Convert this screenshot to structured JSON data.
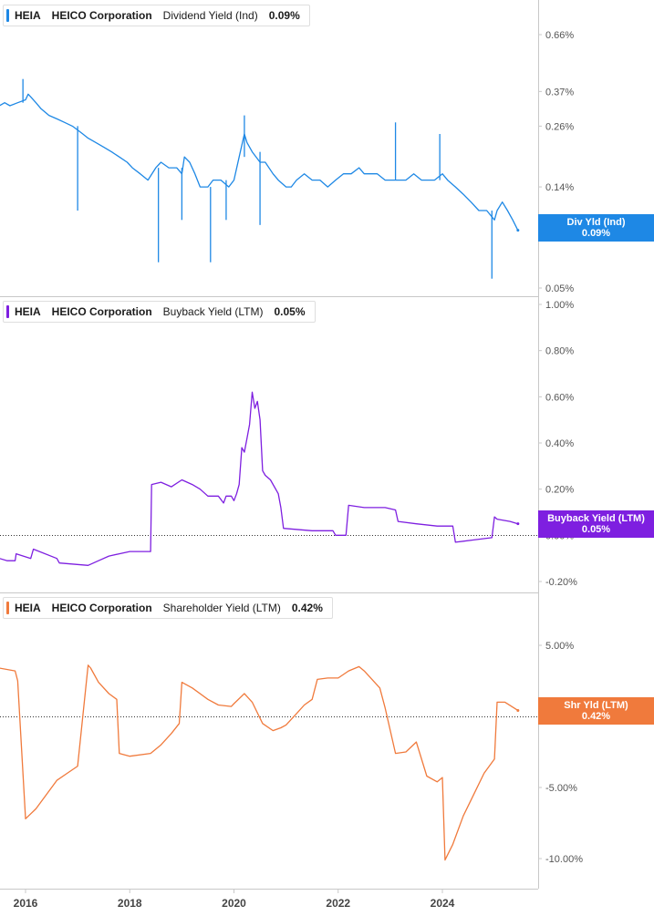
{
  "chart_data": [
    {
      "type": "line",
      "ticker": "HEIA",
      "company": "HEICO Corporation",
      "metric": "Dividend Yield (Ind)",
      "current": "0.09%",
      "tag_label": "Div Yld (Ind)",
      "tag_value": "0.09%",
      "color": "#1e88e5",
      "scale": "log",
      "y_ticks": [
        "0.66%",
        "0.37%",
        "0.26%",
        "0.14%",
        "0.05%"
      ],
      "y_tick_values": [
        0.66,
        0.37,
        0.26,
        0.14,
        0.05
      ],
      "x": [
        2015.5,
        2015.6,
        2015.7,
        2015.85,
        2016.0,
        2016.05,
        2016.1,
        2016.2,
        2016.3,
        2016.45,
        2016.6,
        2016.75,
        2016.9,
        2017.0,
        2017.1,
        2017.2,
        2017.35,
        2017.5,
        2017.65,
        2017.8,
        2017.95,
        2018.05,
        2018.2,
        2018.35,
        2018.5,
        2018.6,
        2018.75,
        2018.9,
        2019.0,
        2019.05,
        2019.15,
        2019.25,
        2019.35,
        2019.5,
        2019.6,
        2019.75,
        2019.9,
        2020.0,
        2020.1,
        2020.2,
        2020.25,
        2020.35,
        2020.5,
        2020.6,
        2020.75,
        2020.85,
        2021.0,
        2021.1,
        2021.2,
        2021.35,
        2021.5,
        2021.65,
        2021.8,
        2021.95,
        2022.1,
        2022.25,
        2022.4,
        2022.5,
        2022.6,
        2022.75,
        2022.9,
        2023.0,
        2023.15,
        2023.3,
        2023.45,
        2023.6,
        2023.7,
        2023.85,
        2024.0,
        2024.1,
        2024.25,
        2024.4,
        2024.55,
        2024.7,
        2024.85,
        2025.0,
        2025.05,
        2025.15,
        2025.25,
        2025.35,
        2025.45
      ],
      "values": [
        0.32,
        0.33,
        0.32,
        0.33,
        0.34,
        0.36,
        0.35,
        0.33,
        0.31,
        0.29,
        0.28,
        0.27,
        0.26,
        0.25,
        0.24,
        0.23,
        0.22,
        0.21,
        0.2,
        0.19,
        0.18,
        0.17,
        0.16,
        0.15,
        0.17,
        0.18,
        0.17,
        0.17,
        0.16,
        0.19,
        0.18,
        0.16,
        0.14,
        0.14,
        0.15,
        0.15,
        0.14,
        0.15,
        0.19,
        0.24,
        0.22,
        0.2,
        0.18,
        0.18,
        0.16,
        0.15,
        0.14,
        0.14,
        0.15,
        0.16,
        0.15,
        0.15,
        0.14,
        0.15,
        0.16,
        0.16,
        0.17,
        0.16,
        0.16,
        0.16,
        0.15,
        0.15,
        0.15,
        0.15,
        0.16,
        0.15,
        0.15,
        0.15,
        0.16,
        0.15,
        0.14,
        0.13,
        0.12,
        0.11,
        0.11,
        0.1,
        0.11,
        0.12,
        0.11,
        0.1,
        0.09
      ],
      "spikes": [
        {
          "x": 2015.95,
          "to": 0.42
        },
        {
          "x": 2017.0,
          "to": 0.11
        },
        {
          "x": 2018.55,
          "to": 0.065
        },
        {
          "x": 2019.0,
          "to": 0.1
        },
        {
          "x": 2019.55,
          "to": 0.065
        },
        {
          "x": 2019.85,
          "to": 0.1
        },
        {
          "x": 2020.2,
          "to": 0.29
        },
        {
          "x": 2020.5,
          "to": 0.095
        },
        {
          "x": 2023.1,
          "to": 0.27
        },
        {
          "x": 2023.95,
          "to": 0.24
        },
        {
          "x": 2024.95,
          "to": 0.055
        }
      ]
    },
    {
      "type": "line",
      "ticker": "HEIA",
      "company": "HEICO Corporation",
      "metric": "Buyback Yield (LTM)",
      "current": "0.05%",
      "tag_label": "Buyback Yield (LTM)",
      "tag_value": "0.05%",
      "color": "#7e1fe0",
      "scale": "linear",
      "ylim": [
        -0.25,
        1.0
      ],
      "y_ticks": [
        "1.00%",
        "0.80%",
        "0.60%",
        "0.40%",
        "0.20%",
        "0.00%",
        "-0.20%"
      ],
      "y_tick_values": [
        1.0,
        0.8,
        0.6,
        0.4,
        0.2,
        0.0,
        -0.2
      ],
      "zero_line": true,
      "x": [
        2015.5,
        2015.65,
        2015.8,
        2015.82,
        2016.1,
        2016.15,
        2016.6,
        2016.65,
        2017.2,
        2017.4,
        2017.6,
        2017.8,
        2018.0,
        2018.4,
        2018.42,
        2018.6,
        2018.8,
        2019.0,
        2019.2,
        2019.35,
        2019.5,
        2019.7,
        2019.8,
        2019.85,
        2019.95,
        2020.0,
        2020.05,
        2020.1,
        2020.15,
        2020.2,
        2020.25,
        2020.3,
        2020.35,
        2020.4,
        2020.45,
        2020.5,
        2020.55,
        2020.6,
        2020.7,
        2020.85,
        2020.9,
        2020.95,
        2021.5,
        2021.9,
        2021.95,
        2022.15,
        2022.2,
        2022.5,
        2022.9,
        2023.1,
        2023.15,
        2023.5,
        2023.9,
        2024.2,
        2024.25,
        2024.6,
        2024.95,
        2025.0,
        2025.05,
        2025.3,
        2025.45
      ],
      "values": [
        -0.1,
        -0.11,
        -0.11,
        -0.08,
        -0.1,
        -0.06,
        -0.1,
        -0.12,
        -0.13,
        -0.11,
        -0.09,
        -0.08,
        -0.07,
        -0.07,
        0.22,
        0.23,
        0.21,
        0.24,
        0.22,
        0.2,
        0.17,
        0.17,
        0.14,
        0.17,
        0.17,
        0.15,
        0.18,
        0.22,
        0.38,
        0.36,
        0.42,
        0.48,
        0.62,
        0.55,
        0.58,
        0.5,
        0.28,
        0.26,
        0.24,
        0.18,
        0.12,
        0.03,
        0.02,
        0.02,
        0.0,
        0.0,
        0.13,
        0.12,
        0.12,
        0.11,
        0.06,
        0.05,
        0.04,
        0.04,
        -0.03,
        -0.02,
        -0.01,
        0.08,
        0.07,
        0.06,
        0.05
      ]
    },
    {
      "type": "line",
      "ticker": "HEIA",
      "company": "HEICO Corporation",
      "metric": "Shareholder Yield (LTM)",
      "current": "0.42%",
      "tag_label": "Shr Yld (LTM)",
      "tag_value": "0.42%",
      "color": "#f07a3c",
      "scale": "linear",
      "ylim": [
        -11.5,
        7.5
      ],
      "y_ticks": [
        "5.00%",
        "0.00%",
        "-5.00%",
        "-10.00%"
      ],
      "y_tick_values": [
        5.0,
        0.0,
        -5.0,
        -10.0
      ],
      "zero_line": true,
      "x": [
        2015.5,
        2015.8,
        2015.85,
        2016.0,
        2016.2,
        2016.4,
        2016.6,
        2016.8,
        2017.0,
        2017.2,
        2017.25,
        2017.4,
        2017.6,
        2017.75,
        2017.8,
        2018.0,
        2018.4,
        2018.6,
        2018.8,
        2018.95,
        2019.0,
        2019.2,
        2019.5,
        2019.7,
        2019.95,
        2020.0,
        2020.2,
        2020.35,
        2020.55,
        2020.75,
        2020.9,
        2021.0,
        2021.2,
        2021.35,
        2021.5,
        2021.6,
        2021.8,
        2022.0,
        2022.2,
        2022.4,
        2022.5,
        2022.6,
        2022.8,
        2022.9,
        2023.1,
        2023.3,
        2023.5,
        2023.7,
        2023.9,
        2024.0,
        2024.05,
        2024.2,
        2024.4,
        2024.6,
        2024.8,
        2025.0,
        2025.05,
        2025.2,
        2025.45
      ],
      "values": [
        3.4,
        3.2,
        2.5,
        -7.2,
        -6.5,
        -5.5,
        -4.5,
        -4.0,
        -3.5,
        3.6,
        3.4,
        2.4,
        1.6,
        1.2,
        -2.6,
        -2.8,
        -2.6,
        -2.0,
        -1.2,
        -0.5,
        2.4,
        2.0,
        1.2,
        0.8,
        0.7,
        0.9,
        1.6,
        1.0,
        -0.5,
        -1.0,
        -0.8,
        -0.6,
        0.2,
        0.8,
        1.2,
        2.6,
        2.7,
        2.7,
        3.2,
        3.5,
        3.2,
        2.8,
        2.0,
        0.6,
        -2.6,
        -2.5,
        -1.8,
        -4.2,
        -4.6,
        -4.3,
        -10.1,
        -9.0,
        -7.0,
        -5.5,
        -4.0,
        -3.0,
        1.0,
        1.0,
        0.42
      ]
    }
  ],
  "x_axis": {
    "ticks": [
      "2016",
      "2018",
      "2020",
      "2022",
      "2024"
    ],
    "tick_values": [
      2016,
      2018,
      2020,
      2022,
      2024
    ]
  }
}
